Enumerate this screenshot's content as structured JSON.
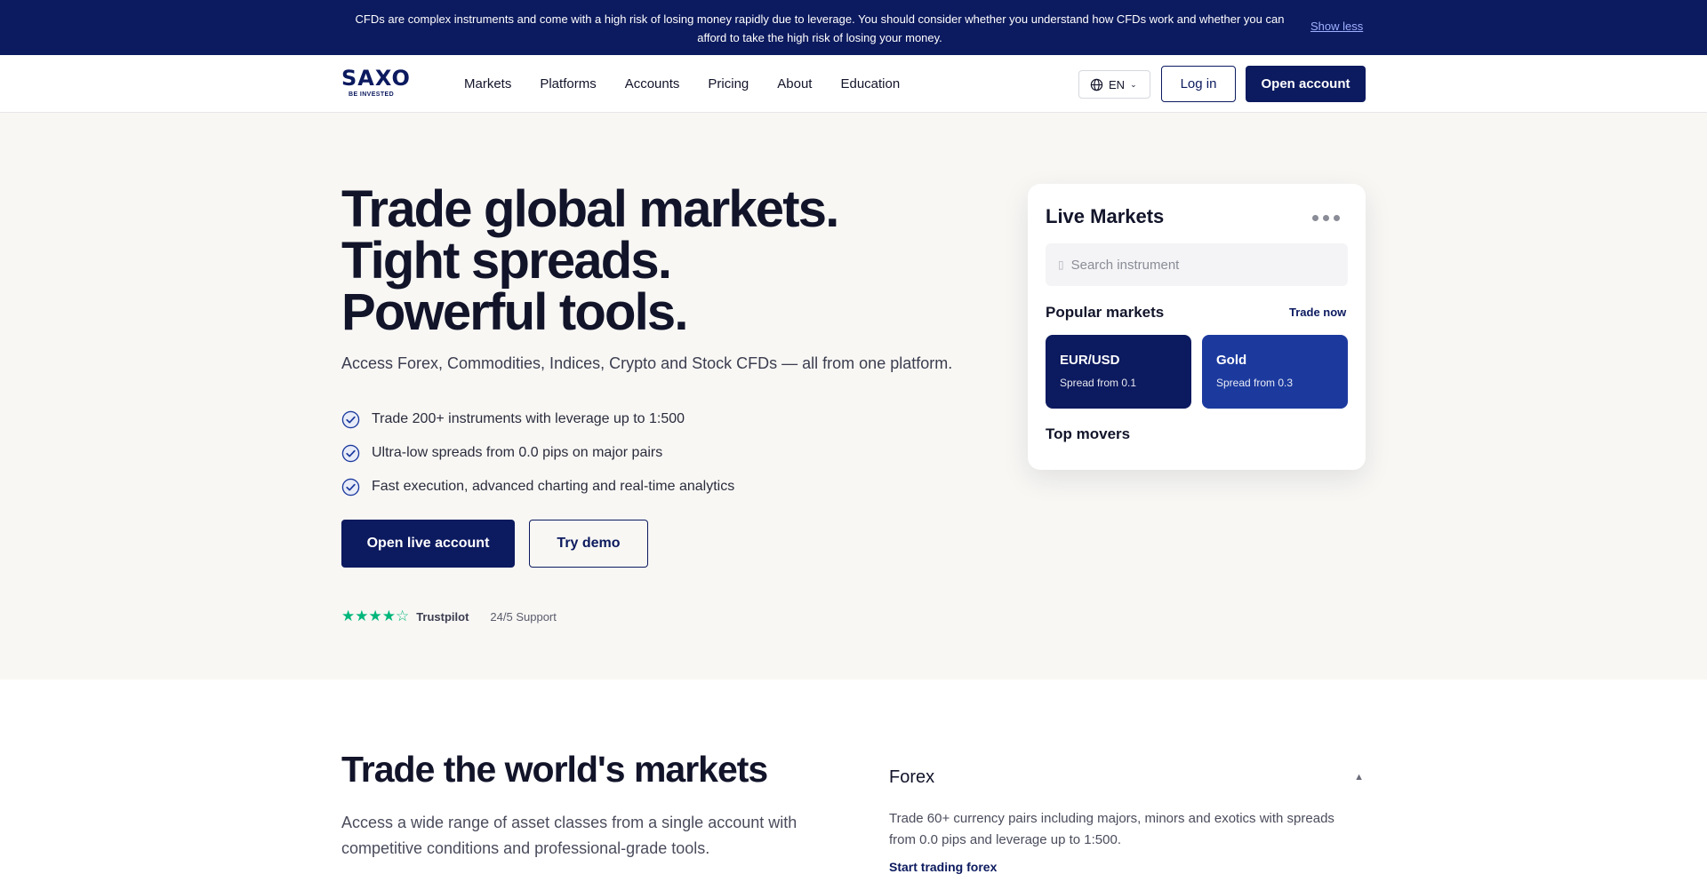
{
  "risk_banner": {
    "text": "CFDs are complex instruments and come with a high risk of losing money rapidly due to leverage. You should consider whether you understand how CFDs work and whether you can afford to take the high risk of losing your money.",
    "toggle_label": "Show less"
  },
  "header": {
    "logo": {
      "word": "SAXO",
      "tagline": "BE INVESTED"
    },
    "nav": [
      "Markets",
      "Platforms",
      "Accounts",
      "Pricing",
      "About",
      "Education"
    ],
    "language": "EN",
    "login_label": "Log in",
    "open_account_label": "Open account"
  },
  "hero": {
    "title_lines": [
      "Trade global markets.",
      "Tight spreads.",
      "Powerful tools."
    ],
    "subtitle": "Access Forex, Commodities, Indices, Crypto and Stock CFDs — all from one platform.",
    "features": [
      "Trade 200+ instruments with leverage up to 1:500",
      "Ultra-low spreads from 0.0 pips on major pairs",
      "Fast execution, advanced charting and real-time analytics"
    ],
    "primary_cta": "Open live account",
    "secondary_cta": "Try demo",
    "rating_stars": "★★★★☆",
    "rating_value": 4,
    "rating_source": "Trustpilot",
    "support_text": "24/5 Support"
  },
  "live_markets": {
    "title": "Live Markets",
    "search_placeholder": "Search instrument",
    "popular_title": "Popular markets",
    "trade_now_label": "Trade now",
    "tiles": [
      {
        "name": "EUR/USD",
        "spread": "Spread from 0.1"
      },
      {
        "name": "Gold",
        "spread": "Spread from 0.3"
      }
    ],
    "top_movers_title": "Top movers"
  },
  "markets_section": {
    "title": "Trade the world's markets",
    "description": "Access a wide range of asset classes from a single account with competitive conditions and professional-grade tools.",
    "accordion": {
      "title": "Forex",
      "body": "Trade 60+ currency pairs including majors, minors and exotics with spreads from 0.0 pips and leverage up to 1:500.",
      "link": "Start trading forex"
    }
  },
  "colors": {
    "brand_navy": "#0c1a5f",
    "tile_blue": "#1c3a9e",
    "hero_bg": "#f8f7f4",
    "trustpilot_green": "#00b67a"
  }
}
